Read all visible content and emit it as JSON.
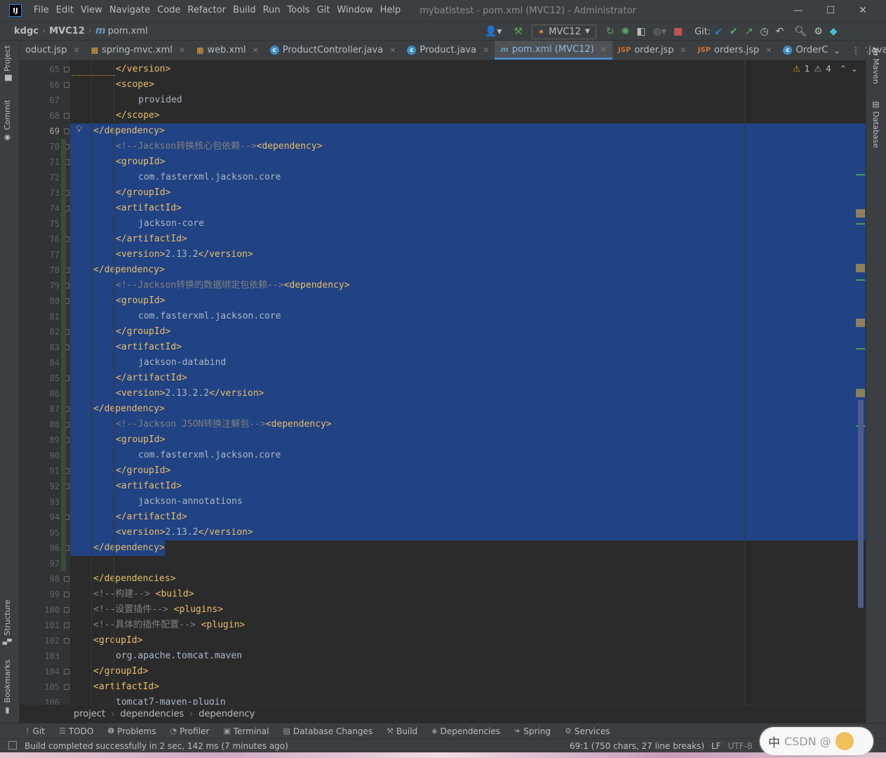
{
  "app": {
    "logo": "IJ",
    "menu": [
      "File",
      "Edit",
      "View",
      "Navigate",
      "Code",
      "Refactor",
      "Build",
      "Run",
      "Tools",
      "Git",
      "Window",
      "Help"
    ],
    "window_title": "mybatistest - pom.xml (MVC12) - Administrator",
    "window_buttons": {
      "minimize": "—",
      "maximize": "☐",
      "close": "✕"
    }
  },
  "navbar": {
    "crumbs": [
      "kdgc",
      "MVC12",
      "pom.xml"
    ],
    "run_config": "MVC12",
    "git_label": "Git:"
  },
  "tabs": [
    {
      "label": "oduct.jsp",
      "icon": "jsp-file-icon",
      "glyph": "",
      "active": false
    },
    {
      "label": "spring-mvc.xml",
      "icon": "xml-file-icon",
      "glyph": "",
      "active": false
    },
    {
      "label": "web.xml",
      "icon": "xml-file-icon",
      "glyph": "",
      "active": false
    },
    {
      "label": "ProductController.java",
      "icon": "class-icon",
      "glyph": "c",
      "active": false
    },
    {
      "label": "Product.java",
      "icon": "class-icon",
      "glyph": "c",
      "active": false
    },
    {
      "label": "pom.xml (MVC12)",
      "icon": "maven-icon",
      "glyph": "m",
      "active": true
    },
    {
      "label": "order.jsp",
      "icon": "jsp-file-icon",
      "glyph": "JSP",
      "active": false
    },
    {
      "label": "orders.jsp",
      "icon": "jsp-file-icon",
      "glyph": "JSP",
      "active": false
    },
    {
      "label": "OrderController.java",
      "icon": "class-icon",
      "glyph": "c",
      "active": false
    }
  ],
  "left_tool_tabs": [
    "Project",
    "Commit",
    "Structure",
    "Bookmarks"
  ],
  "right_tool_tabs": [
    "Maven",
    "Database"
  ],
  "inspection": {
    "warnings": "1",
    "weak_warnings": "4"
  },
  "code": {
    "first_line": 65,
    "current_line": 69,
    "lines": [
      {
        "n": 65,
        "indent": 2,
        "parts": [
          {
            "t": "</version>",
            "c": "tag"
          }
        ],
        "sel": false
      },
      {
        "n": 66,
        "indent": 2,
        "parts": [
          {
            "t": "<scope>",
            "c": "tag"
          }
        ],
        "sel": false
      },
      {
        "n": 67,
        "indent": 3,
        "parts": [
          {
            "t": "provided",
            "c": "txt"
          }
        ],
        "sel": false
      },
      {
        "n": 68,
        "indent": 2,
        "parts": [
          {
            "t": "</scope>",
            "c": "tag"
          }
        ],
        "sel": false
      },
      {
        "n": 69,
        "indent": 1,
        "parts": [
          {
            "t": "</dependency>",
            "c": "tag"
          }
        ],
        "sel": true
      },
      {
        "n": 70,
        "indent": 2,
        "parts": [
          {
            "t": "<!--Jackson转换核心包依赖-->",
            "c": "cmt"
          },
          {
            "t": "<dependency>",
            "c": "tag"
          }
        ],
        "sel": true
      },
      {
        "n": 71,
        "indent": 2,
        "parts": [
          {
            "t": "<groupId>",
            "c": "tag"
          }
        ],
        "sel": true
      },
      {
        "n": 72,
        "indent": 3,
        "parts": [
          {
            "t": "com.fasterxml.jackson.core",
            "c": "txt"
          }
        ],
        "sel": true
      },
      {
        "n": 73,
        "indent": 2,
        "parts": [
          {
            "t": "</groupId>",
            "c": "tag"
          }
        ],
        "sel": true
      },
      {
        "n": 74,
        "indent": 2,
        "parts": [
          {
            "t": "<artifactId>",
            "c": "tag"
          }
        ],
        "sel": true
      },
      {
        "n": 75,
        "indent": 3,
        "parts": [
          {
            "t": "jackson-core",
            "c": "txt"
          }
        ],
        "sel": true
      },
      {
        "n": 76,
        "indent": 2,
        "parts": [
          {
            "t": "</artifactId>",
            "c": "tag"
          }
        ],
        "sel": true
      },
      {
        "n": 77,
        "indent": 2,
        "parts": [
          {
            "t": "<version>",
            "c": "tag"
          },
          {
            "t": "2.13.2",
            "c": "txt"
          },
          {
            "t": "</version>",
            "c": "tag"
          }
        ],
        "sel": true
      },
      {
        "n": 78,
        "indent": 1,
        "parts": [
          {
            "t": "</dependency>",
            "c": "tag"
          }
        ],
        "sel": true
      },
      {
        "n": 79,
        "indent": 2,
        "parts": [
          {
            "t": "<!--Jackson转换的数据绑定包依赖-->",
            "c": "cmt"
          },
          {
            "t": "<dependency>",
            "c": "tag"
          }
        ],
        "sel": true
      },
      {
        "n": 80,
        "indent": 2,
        "parts": [
          {
            "t": "<groupId>",
            "c": "tag"
          }
        ],
        "sel": true
      },
      {
        "n": 81,
        "indent": 3,
        "parts": [
          {
            "t": "com.fasterxml.jackson.core",
            "c": "txt"
          }
        ],
        "sel": true
      },
      {
        "n": 82,
        "indent": 2,
        "parts": [
          {
            "t": "</groupId>",
            "c": "tag"
          }
        ],
        "sel": true
      },
      {
        "n": 83,
        "indent": 2,
        "parts": [
          {
            "t": "<artifactId>",
            "c": "tag"
          }
        ],
        "sel": true
      },
      {
        "n": 84,
        "indent": 3,
        "parts": [
          {
            "t": "jackson-databind",
            "c": "txt"
          }
        ],
        "sel": true
      },
      {
        "n": 85,
        "indent": 2,
        "parts": [
          {
            "t": "</artifactId>",
            "c": "tag"
          }
        ],
        "sel": true
      },
      {
        "n": 86,
        "indent": 2,
        "parts": [
          {
            "t": "<version>",
            "c": "tag"
          },
          {
            "t": "2.13.2.2",
            "c": "txt"
          },
          {
            "t": "</version>",
            "c": "tag"
          }
        ],
        "sel": true
      },
      {
        "n": 87,
        "indent": 1,
        "parts": [
          {
            "t": "</dependency>",
            "c": "tag"
          }
        ],
        "sel": true
      },
      {
        "n": 88,
        "indent": 2,
        "parts": [
          {
            "t": "<!--Jackson JSON转换注解包-->",
            "c": "cmt"
          },
          {
            "t": "<dependency>",
            "c": "tag"
          }
        ],
        "sel": true
      },
      {
        "n": 89,
        "indent": 2,
        "parts": [
          {
            "t": "<groupId>",
            "c": "tag"
          }
        ],
        "sel": true
      },
      {
        "n": 90,
        "indent": 3,
        "parts": [
          {
            "t": "com.fasterxml.jackson.core",
            "c": "txt"
          }
        ],
        "sel": true
      },
      {
        "n": 91,
        "indent": 2,
        "parts": [
          {
            "t": "</groupId>",
            "c": "tag"
          }
        ],
        "sel": true
      },
      {
        "n": 92,
        "indent": 2,
        "parts": [
          {
            "t": "<artifactId>",
            "c": "tag"
          }
        ],
        "sel": true
      },
      {
        "n": 93,
        "indent": 3,
        "parts": [
          {
            "t": "jackson-annotations",
            "c": "txt"
          }
        ],
        "sel": true
      },
      {
        "n": 94,
        "indent": 2,
        "parts": [
          {
            "t": "</artifactId>",
            "c": "tag"
          }
        ],
        "sel": true
      },
      {
        "n": 95,
        "indent": 2,
        "parts": [
          {
            "t": "<version>",
            "c": "tag"
          },
          {
            "t": "2.13.2",
            "c": "txt"
          },
          {
            "t": "</version>",
            "c": "tag"
          }
        ],
        "sel": true
      },
      {
        "n": 96,
        "indent": 1,
        "parts": [
          {
            "t": "</dependency>",
            "c": "tag"
          }
        ],
        "sel": "partial"
      },
      {
        "n": 97,
        "indent": 0,
        "parts": [],
        "sel": false
      },
      {
        "n": 98,
        "indent": 1,
        "parts": [
          {
            "t": "</dependencies>",
            "c": "tag"
          }
        ],
        "sel": false
      },
      {
        "n": 99,
        "indent": 1,
        "parts": [
          {
            "t": "<!--构建--> ",
            "c": "cmt"
          },
          {
            "t": "<build>",
            "c": "tag"
          }
        ],
        "sel": false
      },
      {
        "n": 100,
        "indent": 1,
        "parts": [
          {
            "t": "<!--设置插件--> ",
            "c": "cmt"
          },
          {
            "t": "<plugins>",
            "c": "tag"
          }
        ],
        "sel": false
      },
      {
        "n": 101,
        "indent": 1,
        "parts": [
          {
            "t": "<!--具体的插件配置--> ",
            "c": "cmt"
          },
          {
            "t": "<plugin>",
            "c": "tag"
          }
        ],
        "sel": false
      },
      {
        "n": 102,
        "indent": 1,
        "parts": [
          {
            "t": "<groupId>",
            "c": "tag"
          }
        ],
        "sel": false
      },
      {
        "n": 103,
        "indent": 2,
        "parts": [
          {
            "t": "org.apache.tomcat.maven",
            "c": "txt"
          }
        ],
        "sel": false
      },
      {
        "n": 104,
        "indent": 1,
        "parts": [
          {
            "t": "</groupId>",
            "c": "tag"
          }
        ],
        "sel": false
      },
      {
        "n": 105,
        "indent": 1,
        "parts": [
          {
            "t": "<artifactId>",
            "c": "tag"
          }
        ],
        "sel": false
      },
      {
        "n": 106,
        "indent": 2,
        "parts": [
          {
            "t": "tomcat7-maven-plugin",
            "c": "txt"
          }
        ],
        "sel": false
      }
    ]
  },
  "editor_breadcrumb": [
    "project",
    "dependencies",
    "dependency"
  ],
  "tool_windows": [
    {
      "label": "Git",
      "icon": "git-icon",
      "glyph": "ᚹ"
    },
    {
      "label": "TODO",
      "icon": "todo-icon",
      "glyph": "☰"
    },
    {
      "label": "Problems",
      "icon": "problems-icon",
      "glyph": "❶"
    },
    {
      "label": "Profiler",
      "icon": "profiler-icon",
      "glyph": "◔"
    },
    {
      "label": "Terminal",
      "icon": "terminal-icon",
      "glyph": "▣"
    },
    {
      "label": "Database Changes",
      "icon": "database-changes-icon",
      "glyph": "▤"
    },
    {
      "label": "Build",
      "icon": "build-icon",
      "glyph": "⚒"
    },
    {
      "label": "Dependencies",
      "icon": "dependencies-icon",
      "glyph": "◈"
    },
    {
      "label": "Spring",
      "icon": "spring-icon",
      "glyph": "❧"
    },
    {
      "label": "Services",
      "icon": "services-icon",
      "glyph": "⚙"
    }
  ],
  "status": {
    "message": "Build completed successfully in 2 sec, 142 ms (7 minutes ago)",
    "position": "69:1 (750 chars, 27 line breaks)",
    "line_sep": "LF",
    "encoding": "UTF-8"
  },
  "ime": {
    "lang": "中",
    "overlay_text": "CSDN @"
  },
  "colors": {
    "selection": "#214283",
    "tag": "#e8bf6a",
    "comment": "#808080",
    "text": "#a9b7c6",
    "accent": "#4a88c7"
  }
}
